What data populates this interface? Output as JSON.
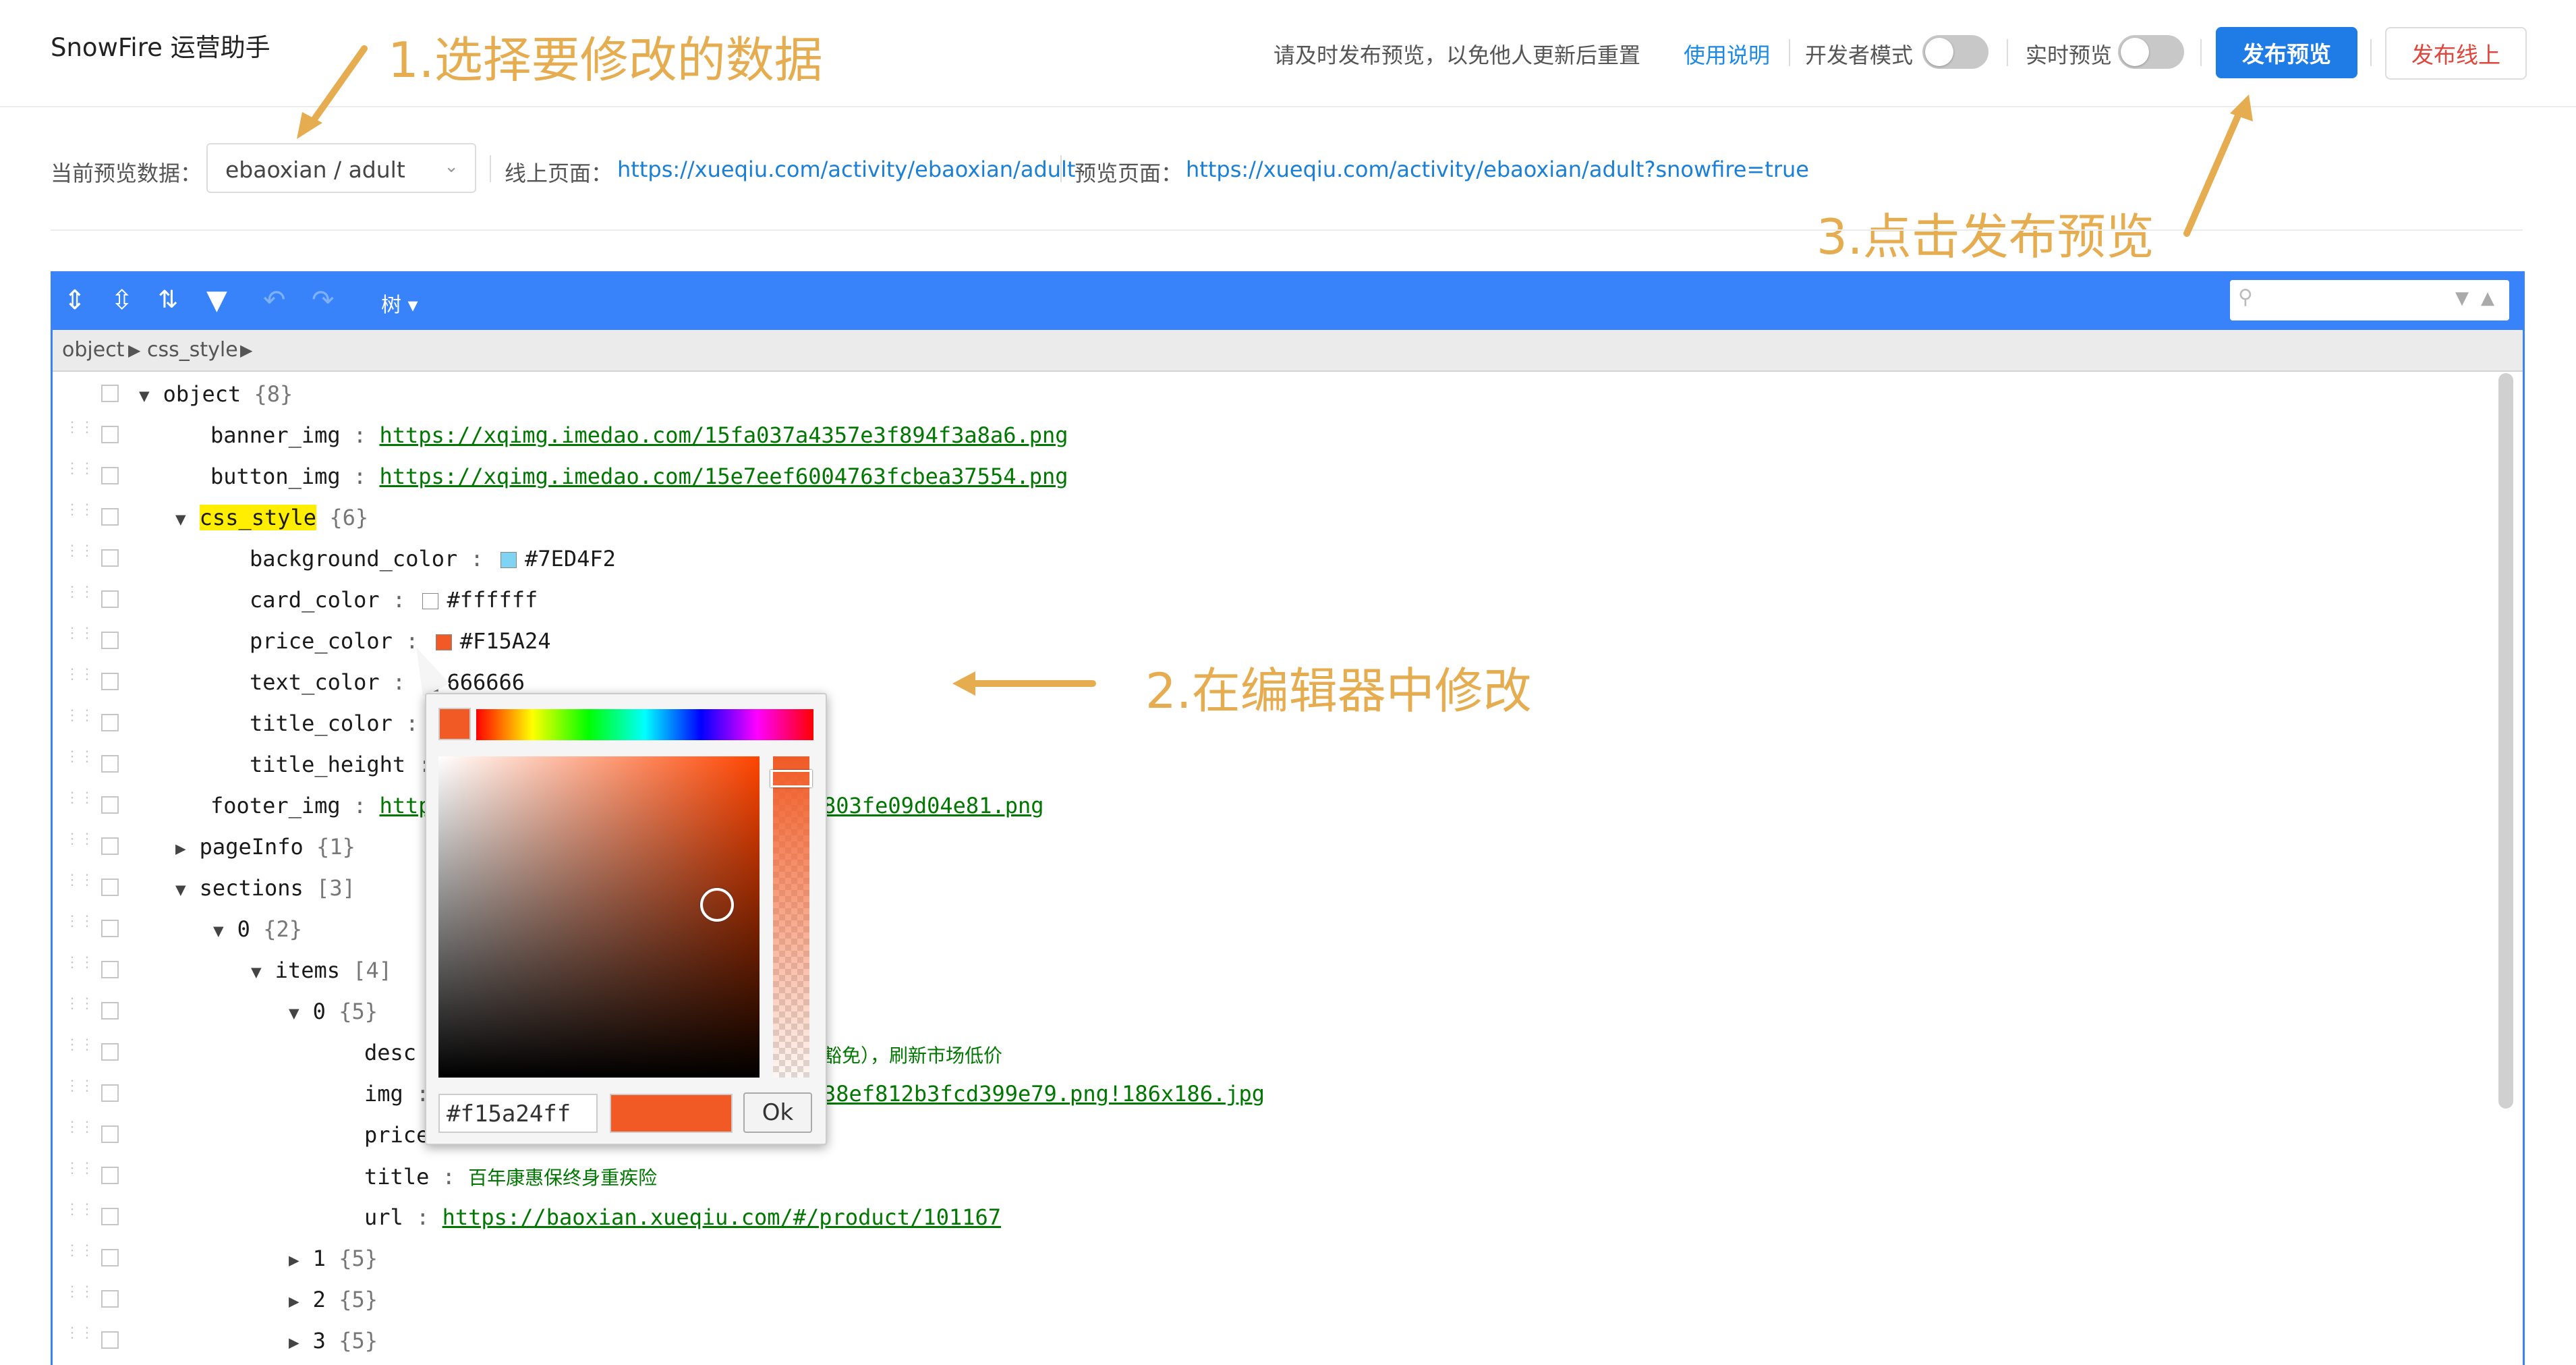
{
  "header": {
    "app_title": "SnowFire 运营助手",
    "notice": "请及时发布预览，以免他人更新后重置",
    "help_link": "使用说明",
    "dev_mode_label": "开发者模式",
    "live_preview_label": "实时预览",
    "publish_preview_label": "发布预览",
    "publish_live_label": "发布线上",
    "accent_color": "#1f7ce6",
    "danger_color": "#e0463c"
  },
  "annotations": {
    "step1": "1.选择要修改的数据",
    "step2": "2.在编辑器中修改",
    "step3": "3.点击发布预览",
    "color": "#e5ad50"
  },
  "info": {
    "current_label": "当前预览数据：",
    "current_value": "ebaoxian / adult",
    "online_label": "线上页面：",
    "online_url": "https://xueqiu.com/activity/ebaoxian/adult",
    "preview_label": "预览页面：",
    "preview_url": "https://xueqiu.com/activity/ebaoxian/adult?snowfire=true"
  },
  "editor": {
    "toolbar": {
      "icons": [
        "expand-all-icon",
        "collapse-all-icon",
        "sort-icon",
        "filter-icon",
        "undo-icon",
        "redo-icon"
      ],
      "mode_label": "树 ▾"
    },
    "breadcrumb": [
      "object",
      "css_style"
    ],
    "tree": {
      "root": {
        "key": "object",
        "count": "{8}"
      },
      "banner_img": {
        "key": "banner_img",
        "value": "https://xqimg.imedao.com/15fa037a4357e3f894f3a8a6.png"
      },
      "button_img": {
        "key": "button_img",
        "value": "https://xqimg.imedao.com/15e7eef6004763fcbea37554.png"
      },
      "css_style": {
        "key": "css_style",
        "count": "{6}"
      },
      "background_color": {
        "key": "background_color",
        "value": "#7ED4F2"
      },
      "card_color": {
        "key": "card_color",
        "value": "#ffffff"
      },
      "price_color": {
        "key": "price_color",
        "value": "#F15A24"
      },
      "text_color": {
        "key": "text_color",
        "value": "#666666",
        "visible": "666666"
      },
      "title_color": {
        "key": "title_color"
      },
      "title_height": {
        "key": "title_height"
      },
      "footer_img": {
        "key": "footer_img",
        "prefix": "https",
        "suffix": "803fe09d04e81.png"
      },
      "pageInfo": {
        "key": "pageInfo",
        "count": "{1}"
      },
      "sections": {
        "key": "sections",
        "count": "[3]"
      },
      "sec0": {
        "key": "0",
        "count": "{2}"
      },
      "items": {
        "key": "items",
        "count": "[4]"
      },
      "item0": {
        "key": "0",
        "count": "{5}"
      },
      "desc": {
        "key": "desc",
        "tail": "豁免），刷新市场低价"
      },
      "img": {
        "key": "img",
        "tail": "38ef812b3fcd399e79.png!186x186.jpg"
      },
      "price": {
        "key": "price"
      },
      "title": {
        "key": "title",
        "value": "百年康惠保终身重疾险"
      },
      "url": {
        "key": "url",
        "value": "https://baoxian.xueqiu.com/#/product/101167"
      },
      "item1": {
        "key": "1",
        "count": "{5}"
      },
      "item2": {
        "key": "2",
        "count": "{5}"
      },
      "item3": {
        "key": "3",
        "count": "{5}"
      }
    },
    "colors": {
      "bg": "#7ED4F2",
      "card": "#ffffff",
      "price": "#F15A24",
      "text": "#666666"
    }
  },
  "color_picker": {
    "hex_value": "#f15a24ff",
    "ok_label": "Ok",
    "current_color": "#f15a24"
  }
}
